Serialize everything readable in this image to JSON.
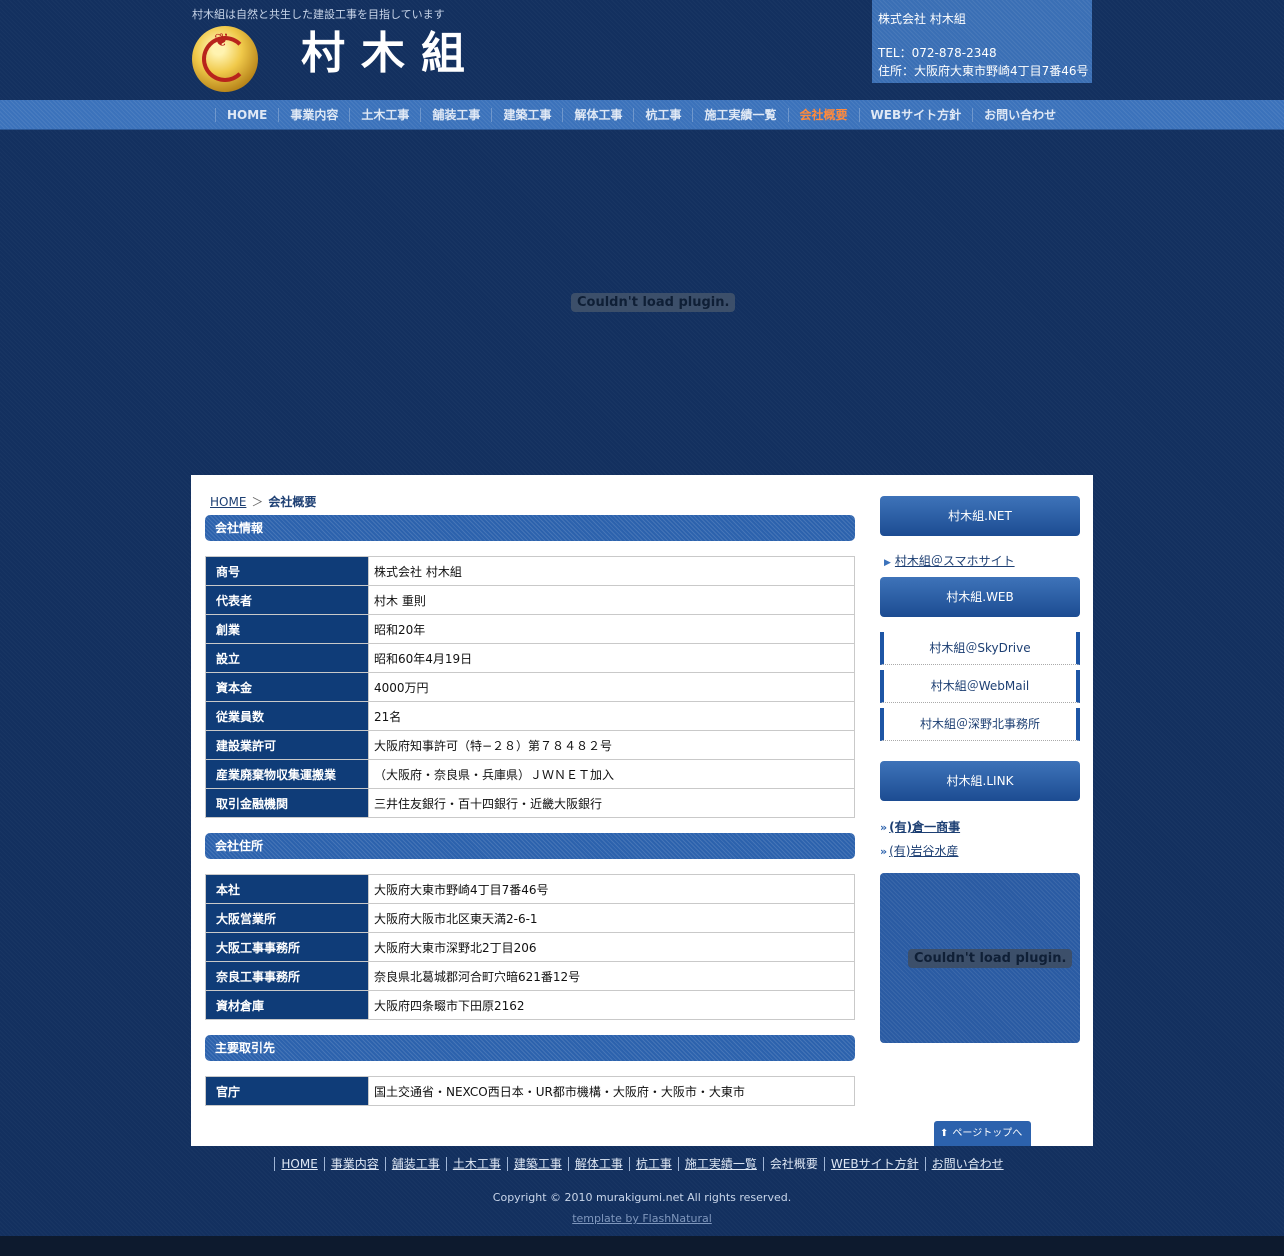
{
  "header": {
    "tagline": "村木組は自然と共生した建設工事を目指しています",
    "site_name": "村木組",
    "company_name": "株式会社 村木組",
    "tel": "TEL：072-878-2348",
    "address": "住所：大阪府大東市野崎4丁目7番46号"
  },
  "nav": {
    "items": [
      "HOME",
      "事業内容",
      "土木工事",
      "舗装工事",
      "建築工事",
      "解体工事",
      "杭工事",
      "施工実績一覧",
      "会社概要",
      "WEBサイト方針",
      "お問い合わせ"
    ],
    "active": "会社概要"
  },
  "plugin_message": "Couldn't load plugin.",
  "breadcrumb": {
    "home": "HOME",
    "separator": "＞",
    "current": "会社概要"
  },
  "sections": {
    "company_info": {
      "title": "会社情報",
      "rows": [
        {
          "key": "商号",
          "value": "株式会社 村木組"
        },
        {
          "key": "代表者",
          "value": "村木 重則"
        },
        {
          "key": "創業",
          "value": "昭和20年"
        },
        {
          "key": "設立",
          "value": "昭和60年4月19日"
        },
        {
          "key": "資本金",
          "value": "4000万円"
        },
        {
          "key": "従業員数",
          "value": "21名"
        },
        {
          "key": "建設業許可",
          "value": "大阪府知事許可（特−２８）第７８４８２号"
        },
        {
          "key": "産業廃棄物収集運搬業",
          "value": "（大阪府・奈良県・兵庫県）ＪＷＮＥＴ加入"
        },
        {
          "key": "取引金融機関",
          "value": "三井住友銀行・百十四銀行・近畿大阪銀行"
        }
      ]
    },
    "company_address": {
      "title": "会社住所",
      "rows": [
        {
          "key": "本社",
          "value": "大阪府大東市野崎4丁目7番46号"
        },
        {
          "key": "大阪営業所",
          "value": "大阪府大阪市北区東天満2-6-1"
        },
        {
          "key": "大阪工事事務所",
          "value": "大阪府大東市深野北2丁目206"
        },
        {
          "key": "奈良工事事務所",
          "value": "奈良県北葛城郡河合町穴暗621番12号"
        },
        {
          "key": "資材倉庫",
          "value": "大阪府四条畷市下田原2162"
        }
      ]
    },
    "clients": {
      "title": "主要取引先",
      "rows": [
        {
          "key": "官庁",
          "value": "国土交通省・NEXCO西日本・UR都市機構・大阪府・大阪市・大東市"
        }
      ]
    }
  },
  "sidebar": {
    "net_title": "村木組.NET",
    "net_link": "村木組＠スマホサイト",
    "web_title": "村木組.WEB",
    "web_links": [
      "村木組＠SkyDrive",
      "村木組＠WebMail",
      "村木組＠深野北事務所"
    ],
    "link_title": "村木組.LINK",
    "links": [
      "(有)倉一商事",
      "(有)岩谷水産"
    ]
  },
  "pagetop": "ページトップへ",
  "footer": {
    "nav": [
      "HOME",
      "事業内容",
      "舗装工事",
      "土木工事",
      "建築工事",
      "解体工事",
      "杭工事",
      "施工実績一覧",
      "会社概要",
      "WEBサイト方針",
      "お問い合わせ"
    ],
    "copyright": "Copyright © 2010 murakigumi.net All rights reserved.",
    "template": "template by FlashNatural"
  },
  "colors": {
    "background": "#13305f",
    "nav": "#3b72bb",
    "table_key": "#0f3c78",
    "active_nav": "#ff8a3c"
  }
}
